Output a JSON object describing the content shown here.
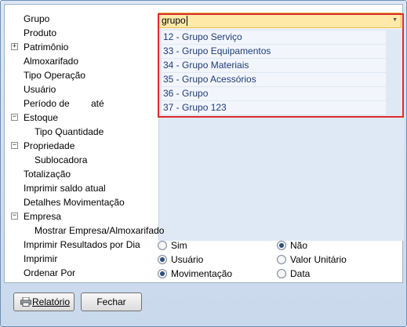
{
  "filter_labels": {
    "grupo": "Grupo",
    "produto": "Produto",
    "patrimonio": "Patrimônio",
    "almoxarifado": "Almoxarifado",
    "tipo_operacao": "Tipo Operação",
    "usuario": "Usuário",
    "periodo_de": "Período de",
    "periodo_ate": "até",
    "estoque": "Estoque",
    "tipo_quantidade": "Tipo Quantidade",
    "propriedade": "Propriedade",
    "sublocadora": "Sublocadora",
    "totalizacao": "Totalização",
    "imprimir_saldo": "Imprimir saldo atual",
    "detalhes_mov": "Detalhes Movimentação",
    "empresa": "Empresa",
    "mostrar_empresa": "Mostrar Empresa/Almoxarifado",
    "imprimir_resultados": "Imprimir Resultados por Dia",
    "imprimir": "Imprimir",
    "ordenar_por": "Ordenar Por"
  },
  "toggles": {
    "expand": "+",
    "collapse": "−"
  },
  "grupo_combo": {
    "value": "grupo",
    "items": [
      "12 - Grupo Serviço",
      "33 - Grupo Equipamentos",
      "34 - Grupo Materiais",
      "35 - Grupo Acessórios",
      "36 - Grupo",
      "37 - Grupo 123"
    ]
  },
  "options": {
    "resultados_por_dia": {
      "opt1": "Sim",
      "opt2": "Não",
      "selected": "Não"
    },
    "imprimir": {
      "opt1": "Usuário",
      "opt2": "Valor Unitário",
      "selected": "Usuário"
    },
    "ordenar_por": {
      "opt1": "Movimentação",
      "opt2": "Data",
      "selected": "Movimentação"
    }
  },
  "buttons": {
    "relatorio": "Relatório",
    "fechar": "Fechar"
  },
  "colors": {
    "highlight_border": "#e02a2a",
    "combo_bg": "#ffe9a8",
    "list_text": "#1f3d7a"
  }
}
